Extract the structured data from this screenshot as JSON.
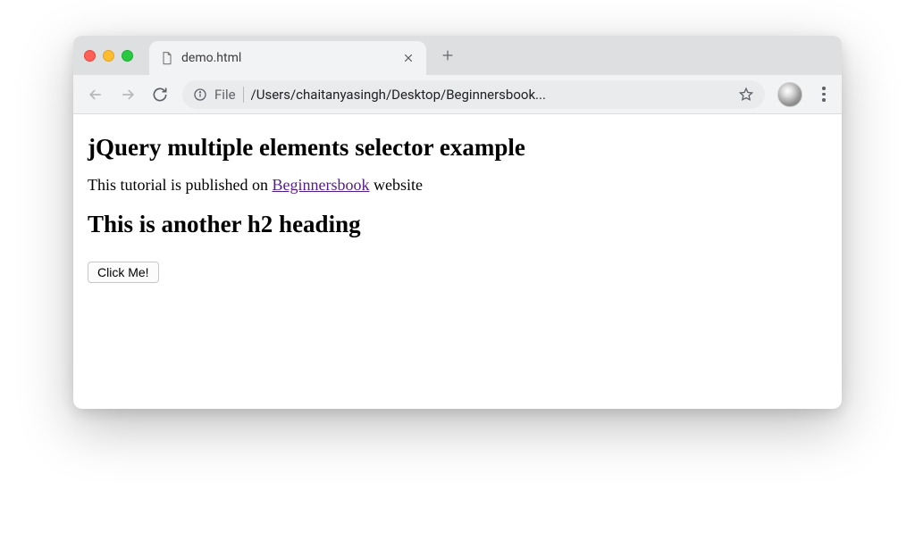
{
  "tab": {
    "title": "demo.html"
  },
  "address": {
    "scheme": "File",
    "path": "/Users/chaitanyasingh/Desktop/Beginnersbook..."
  },
  "page": {
    "heading1": "jQuery multiple elements selector example",
    "para_before": "This tutorial is published on ",
    "link_text": "Beginnersbook",
    "para_after": " website",
    "heading2": "This is another h2 heading",
    "button_label": "Click Me!"
  }
}
